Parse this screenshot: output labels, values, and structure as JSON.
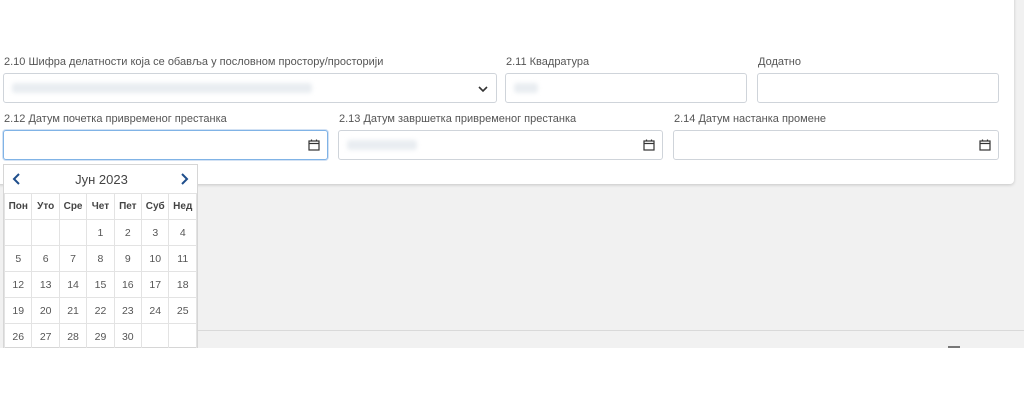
{
  "form": {
    "field_2_10": {
      "label": "2.10 Шифра делатности која се обавља у пословном простору/просторији",
      "icon": "chevron-down-icon"
    },
    "field_2_11": {
      "label": "2.11 Квадратура"
    },
    "field_extra": {
      "label": "Додатно"
    },
    "field_2_12": {
      "label": "2.12 Датум почетка привременог престанка",
      "icon": "calendar-icon"
    },
    "field_2_13": {
      "label": "2.13 Датум завршетка привременог престанка",
      "icon": "calendar-icon"
    },
    "field_2_14": {
      "label": "2.14 Датум настанка промене",
      "icon": "calendar-icon"
    }
  },
  "datepicker": {
    "month_title": "Јун 2023",
    "weekdays": [
      "Пон",
      "Уто",
      "Сре",
      "Чет",
      "Пет",
      "Суб",
      "Нед"
    ],
    "weeks": [
      [
        "",
        "",
        "",
        "1",
        "2",
        "3",
        "4"
      ],
      [
        "5",
        "6",
        "7",
        "8",
        "9",
        "10",
        "11"
      ],
      [
        "12",
        "13",
        "14",
        "15",
        "16",
        "17",
        "18"
      ],
      [
        "19",
        "20",
        "21",
        "22",
        "23",
        "24",
        "25"
      ],
      [
        "26",
        "27",
        "28",
        "29",
        "30",
        "",
        ""
      ]
    ],
    "prev_icon": "chevron-left-icon",
    "next_icon": "chevron-right-icon"
  },
  "colors": {
    "accent": "#1f4e8c",
    "focus_border": "#80b3e6",
    "page_bg": "#f1f1f1"
  }
}
